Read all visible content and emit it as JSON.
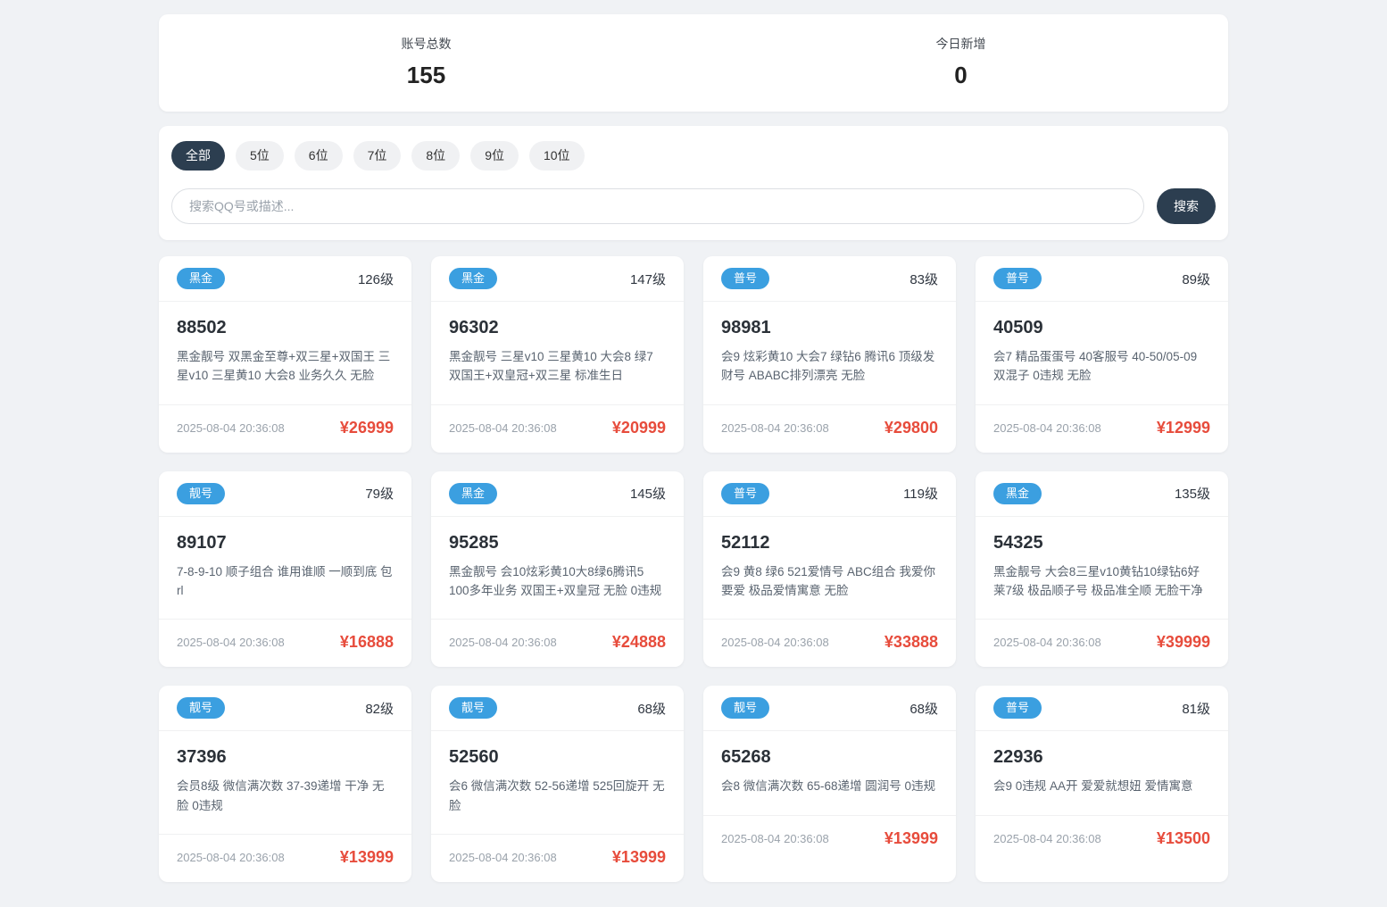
{
  "stats": {
    "total_label": "账号总数",
    "total_value": "155",
    "today_label": "今日新增",
    "today_value": "0"
  },
  "filters": {
    "tabs": [
      {
        "label": "全部",
        "active": true
      },
      {
        "label": "5位",
        "active": false
      },
      {
        "label": "6位",
        "active": false
      },
      {
        "label": "7位",
        "active": false
      },
      {
        "label": "8位",
        "active": false
      },
      {
        "label": "9位",
        "active": false
      },
      {
        "label": "10位",
        "active": false
      }
    ],
    "search_placeholder": "搜索QQ号或描述...",
    "search_button": "搜索"
  },
  "colors": {
    "badge_blue": "#3b9fe0",
    "accent_dark": "#2c3e50",
    "price_red": "#e74c3c"
  },
  "cards": [
    {
      "badge": "黑金",
      "level": "126级",
      "number": "88502",
      "desc": "黑金靓号 双黑金至尊+双三星+双国王 三星v10 三星黄10 大会8 业务久久 无脸",
      "date": "2025-08-04 20:36:08",
      "price": "¥26999"
    },
    {
      "badge": "黑金",
      "level": "147级",
      "number": "96302",
      "desc": "黑金靓号 三星v10 三星黄10 大会8 绿7 双国王+双皇冠+双三星 标准生日",
      "date": "2025-08-04 20:36:08",
      "price": "¥20999"
    },
    {
      "badge": "普号",
      "level": "83级",
      "number": "98981",
      "desc": "会9 炫彩黄10 大会7 绿钻6 腾讯6 顶级发财号 ABABC排列漂亮 无脸",
      "date": "2025-08-04 20:36:08",
      "price": "¥29800"
    },
    {
      "badge": "普号",
      "level": "89级",
      "number": "40509",
      "desc": "会7 精品蛋蛋号 40客服号 40-50/05-09 双混子 0违规 无脸",
      "date": "2025-08-04 20:36:08",
      "price": "¥12999"
    },
    {
      "badge": "靓号",
      "level": "79级",
      "number": "89107",
      "desc": "7-8-9-10 顺子组合 谁用谁顺 一顺到底 包rl",
      "date": "2025-08-04 20:36:08",
      "price": "¥16888"
    },
    {
      "badge": "黑金",
      "level": "145级",
      "number": "95285",
      "desc": "黑金靓号 会10炫彩黄10大8绿6腾讯5 100多年业务 双国王+双皇冠 无脸 0违规",
      "date": "2025-08-04 20:36:08",
      "price": "¥24888"
    },
    {
      "badge": "普号",
      "level": "119级",
      "number": "52112",
      "desc": "会9 黄8 绿6 521爱情号 ABC组合 我爱你要爱 极品爱情寓意 无脸",
      "date": "2025-08-04 20:36:08",
      "price": "¥33888"
    },
    {
      "badge": "黑金",
      "level": "135级",
      "number": "54325",
      "desc": "黑金靓号 大会8三星v10黄钻10绿钻6好莱7级 极品顺子号 极品准全顺 无脸干净",
      "date": "2025-08-04 20:36:08",
      "price": "¥39999"
    },
    {
      "badge": "靓号",
      "level": "82级",
      "number": "37396",
      "desc": "会员8级 微信满次数 37-39递增 干净 无脸 0违规",
      "date": "2025-08-04 20:36:08",
      "price": "¥13999"
    },
    {
      "badge": "靓号",
      "level": "68级",
      "number": "52560",
      "desc": "会6 微信满次数 52-56递增 525回旋开 无脸",
      "date": "2025-08-04 20:36:08",
      "price": "¥13999"
    },
    {
      "badge": "靓号",
      "level": "68级",
      "number": "65268",
      "desc": "会8 微信满次数 65-68递增 圆润号 0违规",
      "date": "2025-08-04 20:36:08",
      "price": "¥13999"
    },
    {
      "badge": "普号",
      "level": "81级",
      "number": "22936",
      "desc": "会9 0违规 AA开 爱爱就想妞 爱情寓意",
      "date": "2025-08-04 20:36:08",
      "price": "¥13500"
    }
  ]
}
